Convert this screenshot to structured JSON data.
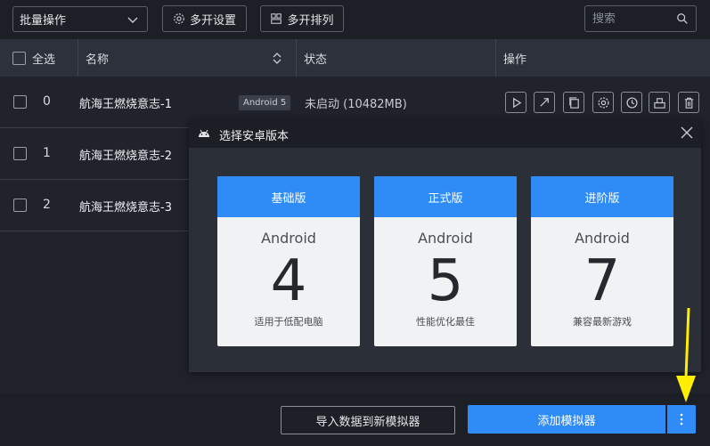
{
  "toolbar": {
    "batch_select": "批量操作",
    "multi_settings": "多开设置",
    "multi_arrange": "多开排列",
    "search_placeholder": "搜索"
  },
  "table": {
    "headers": {
      "select_all": "全选",
      "name": "名称",
      "status": "状态",
      "actions": "操作"
    },
    "rows": [
      {
        "index": "0",
        "name": "航海王燃烧意志-1",
        "badge": "Android 5",
        "status": "未启动 (10482MB)"
      },
      {
        "index": "1",
        "name": "航海王燃烧意志-2"
      },
      {
        "index": "2",
        "name": "航海王燃烧意志-3"
      }
    ],
    "action_icons": [
      "play-icon",
      "arrow-icon",
      "copy-icon",
      "gear-icon",
      "history-icon",
      "organize-icon",
      "trash-icon"
    ]
  },
  "dialog": {
    "title": "选择安卓版本",
    "cards": [
      {
        "header": "基础版",
        "os": "Android",
        "version": "4",
        "description": "适用于低配电脑"
      },
      {
        "header": "正式版",
        "os": "Android",
        "version": "5",
        "description": "性能优化最佳"
      },
      {
        "header": "进阶版",
        "os": "Android",
        "version": "7",
        "description": "兼容最新游戏"
      }
    ]
  },
  "footer": {
    "import_label": "导入数据到新模拟器",
    "add_label": "添加模拟器"
  },
  "colors": {
    "accent": "#2f8cf7",
    "background": "#20232b",
    "annotation_arrow": "#ffee00"
  }
}
